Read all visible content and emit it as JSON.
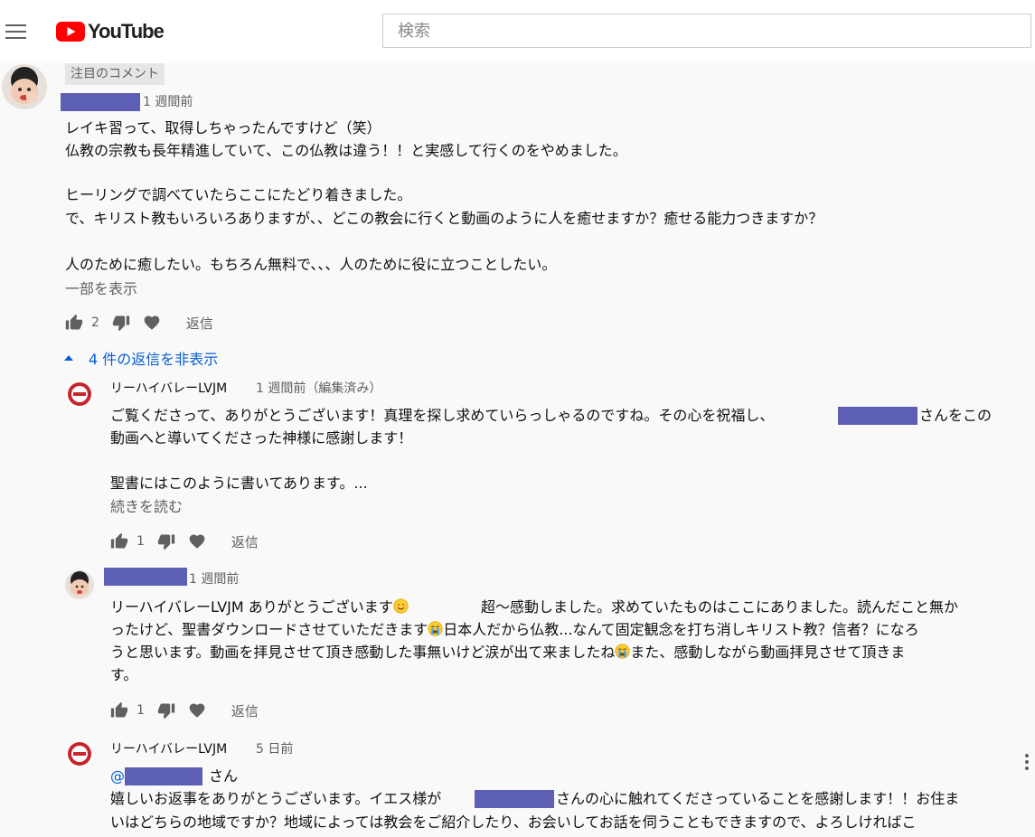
{
  "header": {
    "logo_text": "YouTube",
    "search_placeholder": "検索"
  },
  "colors": {
    "brand_red": "#ff0000",
    "link_blue": "#065fd4",
    "redaction": "#5d5fb4"
  },
  "comment": {
    "pinned_label": "注目のコメント",
    "time": "1 週間前",
    "lines": [
      "レイキ習って、取得しちゃったんですけど（笑）",
      "仏教の宗教も長年精進していて、この仏教は違う！！と実感して行くのをやめました。",
      "ヒーリングで調べていたらここにたどり着きました。",
      "で、キリスト教もいろいろありますが、、どこの教会に行くと動画のように人を癒せますか？癒せる能力つきますか？",
      "人のために癒したい。もちろん無料で、、、人のために役に立つことしたい。"
    ],
    "show_more": "一部を表示",
    "likes": "2",
    "reply_label": "返信",
    "toggle_replies": "4 件の返信を非表示"
  },
  "replies": [
    {
      "author": "リーハイバレーLVJM",
      "time": "1 週間前（編集済み）",
      "line1_a": "ご覧くださって、ありがとうございます！真理を探し求めていらっしゃるのですね。その心を祝福し、",
      "line1_b": "さんをこの",
      "line2": "動画へと導いてくださった神様に感謝します！",
      "line3": "聖書にはこのように書いてあります。...",
      "read_more": "続きを読む",
      "likes": "1",
      "reply_label": "返信"
    },
    {
      "time": "1 週間前",
      "line1_a": "リーハイバレーLVJM ありがとうございます",
      "line1_b": "超〜感動しました。求めていたものはここにありました。読んだこと無か",
      "line2_a": "ったけど、聖書ダウンロードさせていただきます",
      "line2_b": "日本人だから仏教...なんて固定観念を打ち消しキリスト教？信者？になろ",
      "line3_a": "うと思います。動画を拝見させて頂き感動した事無いけど涙が出て来ましたね",
      "line3_b": "また、感動しながら動画拝見させて頂きま",
      "line4": "す。",
      "likes": "1",
      "reply_label": "返信"
    },
    {
      "author": "リーハイバレーLVJM",
      "time": "5 日前",
      "mention_at": "@",
      "mention_suffix": "さん",
      "line1_a": "嬉しいお返事をありがとうございます。イエス様が",
      "line1_b": "さんの心に触れてくださっていることを感謝します！！お住ま",
      "line2": "いはどちらの地域ですか？地域によっては教会をご紹介したり、お会いしてお話を伺うこともできますので、よろしければこ"
    }
  ]
}
